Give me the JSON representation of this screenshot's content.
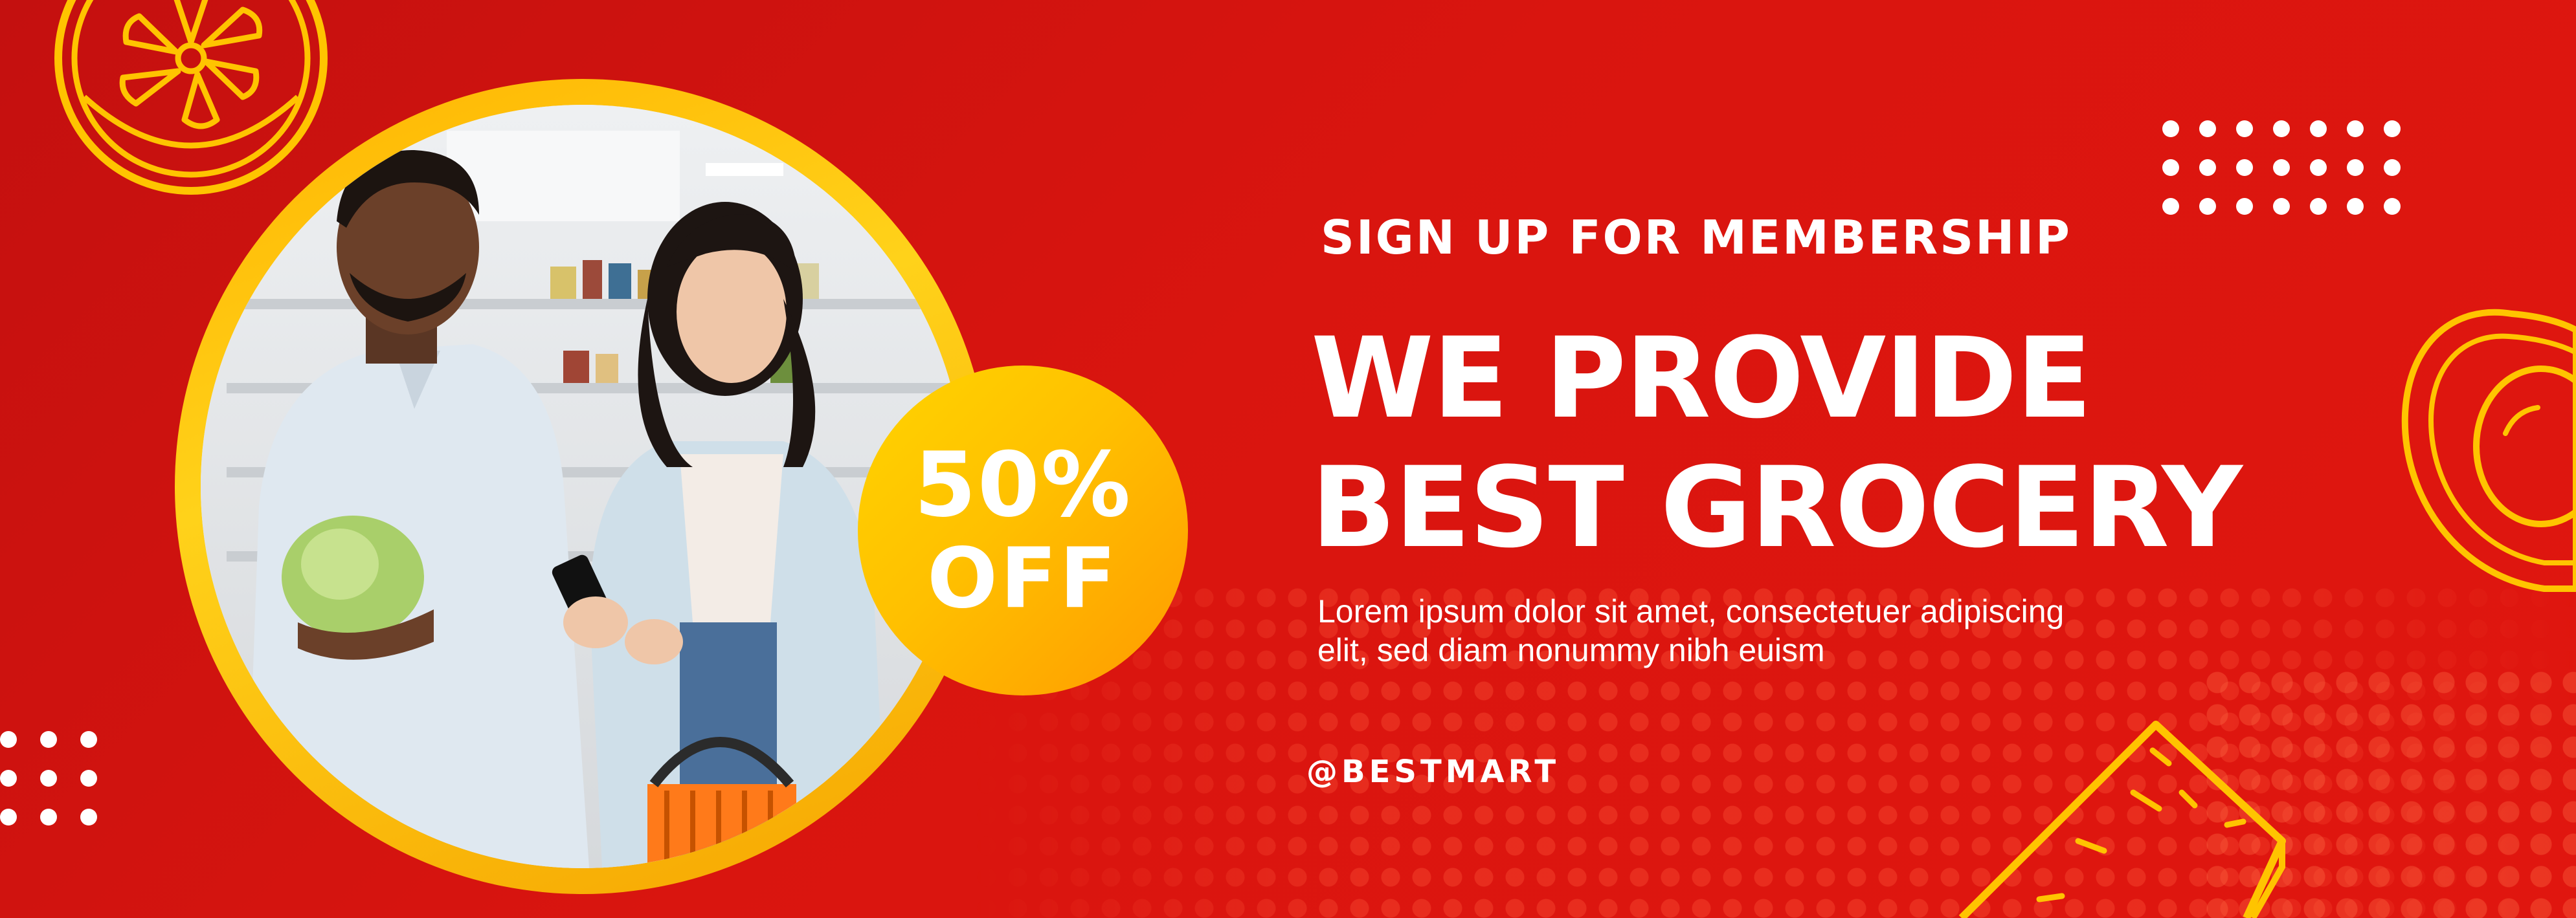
{
  "banner": {
    "eyebrow": "SIGN UP FOR MEMBERSHIP",
    "headline_line1": "WE PROVIDE",
    "headline_line2": "BEST GROCERY",
    "body_line1": "Lorem ipsum dolor sit amet, consectetuer adipiscing",
    "body_line2": "elit, sed diam nonummy nibh euism",
    "handle": "@BESTMART"
  },
  "badge": {
    "percent": "50%",
    "off": "OFF"
  },
  "photo": {
    "subject": "couple shopping in grocery store photo"
  },
  "icons": {
    "top_left": "citrus-slice-icon",
    "right": "avocado-icon",
    "bottom_right": "cheese-wedge-icon",
    "dot_grid_top": "dot-grid-icon",
    "dot_grid_left": "dot-grid-icon"
  },
  "colors": {
    "background": "#d2120f",
    "accent_yellow": "#ffc400",
    "badge_orange": "#ff9a00",
    "text": "#ffffff"
  }
}
